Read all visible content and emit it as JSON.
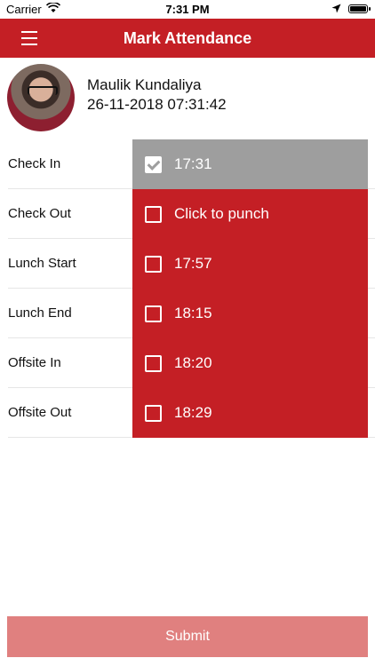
{
  "status_bar": {
    "carrier": "Carrier",
    "time": "7:31 PM",
    "wifi_icon": "wifi-icon",
    "location_icon": "location-arrow-icon",
    "battery_icon": "battery-icon"
  },
  "header": {
    "title": "Mark Attendance",
    "menu_icon": "hamburger-menu-icon",
    "color": "#c41f25"
  },
  "profile": {
    "name": "Maulik Kundaliya",
    "datetime": "26-11-2018 07:31:42"
  },
  "punches": [
    {
      "label": "Check In",
      "value": "17:31",
      "checked": true
    },
    {
      "label": "Check Out",
      "value": "Click to punch",
      "checked": false
    },
    {
      "label": "Lunch Start",
      "value": "17:57",
      "checked": false
    },
    {
      "label": "Lunch End",
      "value": "18:15",
      "checked": false
    },
    {
      "label": "Offsite In",
      "value": "18:20",
      "checked": false
    },
    {
      "label": "Offsite Out",
      "value": "18:29",
      "checked": false
    }
  ],
  "submit": {
    "label": "Submit"
  },
  "colors": {
    "accent": "#c41f25",
    "done": "#9e9e9e",
    "submit_disabled": "#e0807f"
  }
}
